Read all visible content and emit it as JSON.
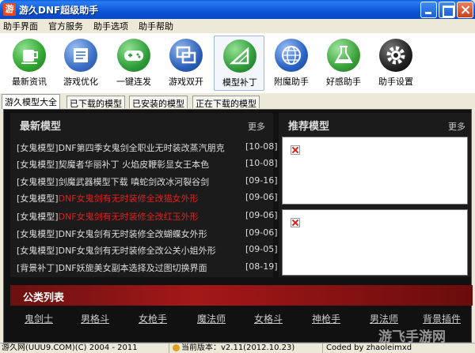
{
  "window": {
    "title": "游久DNF超级助手",
    "app_icon_letter": "游"
  },
  "menu": [
    "助手界面",
    "官方服务",
    "助手选项",
    "助手帮助"
  ],
  "toolbar": [
    {
      "label": "最新资讯",
      "icon": "cup-icon",
      "color": "#2fa52f"
    },
    {
      "label": "游戏优化",
      "icon": "scroll-icon",
      "color": "#3b6fc6"
    },
    {
      "label": "一键连发",
      "icon": "gamepad-icon",
      "color": "#2f9e3a"
    },
    {
      "label": "游戏双开",
      "icon": "windows-icon",
      "color": "#2c5fb8"
    },
    {
      "label": "模型补丁",
      "icon": "ruler-icon",
      "color": "#2f9b3a"
    },
    {
      "label": "附魔助手",
      "icon": "globe-icon",
      "color": "#2a63c4"
    },
    {
      "label": "好感助手",
      "icon": "beaker-icon",
      "color": "#3aa23a"
    },
    {
      "label": "助手设置",
      "icon": "gear-icon",
      "color": "#222222"
    }
  ],
  "tabs": [
    "游久模型大全",
    "已下载的模型",
    "已安装的模型",
    "正在下载的模型"
  ],
  "latest": {
    "title": "最新模型",
    "more": "更多",
    "items": [
      {
        "cat": "[女鬼模型]",
        "text": "DNF第四季女鬼剑全职业无时装改蒸汽朋克",
        "date": "[10-08]",
        "red": false
      },
      {
        "cat": "[女鬼模型]",
        "text": "契魔者华丽补丁 火焰皮鞭彰显女王本色",
        "date": "[10-08]",
        "red": false
      },
      {
        "cat": "[女鬼模型]",
        "text": "剑魔武器模型下载 嗔蛇剑改冰河裂谷剑",
        "date": "[09-16]",
        "red": false
      },
      {
        "cat": "[女鬼模型]",
        "text": "DNF女鬼剑有无时装修全改猫女外形",
        "date": "[09-06]",
        "red": true
      },
      {
        "cat": "[女鬼模型]",
        "text": "DNF女鬼剑有无时装修全改红玉外形",
        "date": "[09-06]",
        "red": true
      },
      {
        "cat": "[女鬼模型]",
        "text": "DNF女鬼剑有无时装修全改蝴蝶女外形",
        "date": "[09-06]",
        "red": false
      },
      {
        "cat": "[女鬼模型]",
        "text": "DNF女鬼剑有无时装修全改公关小姐外形",
        "date": "[09-05]",
        "red": false
      },
      {
        "cat": "[背景补丁]",
        "text": "DNF妖旎美女副本选择及过图切换界面",
        "date": "[08-19]",
        "red": false
      }
    ]
  },
  "recommend": {
    "title": "推荐模型",
    "more": "更多"
  },
  "public": {
    "title": "公类列表",
    "categories": [
      "鬼剑士",
      "男格斗",
      "女枪手",
      "魔法师",
      "女格斗",
      "神枪手",
      "男法师",
      "背景插件"
    ]
  },
  "status": {
    "copyright": "游久网(UUU9.COM)(C) 2004 - 2011",
    "version": "当前版本：v2.11(2012.10.23)",
    "coded": "Coded by zhaoleimxd"
  },
  "watermark": "游飞手游网"
}
